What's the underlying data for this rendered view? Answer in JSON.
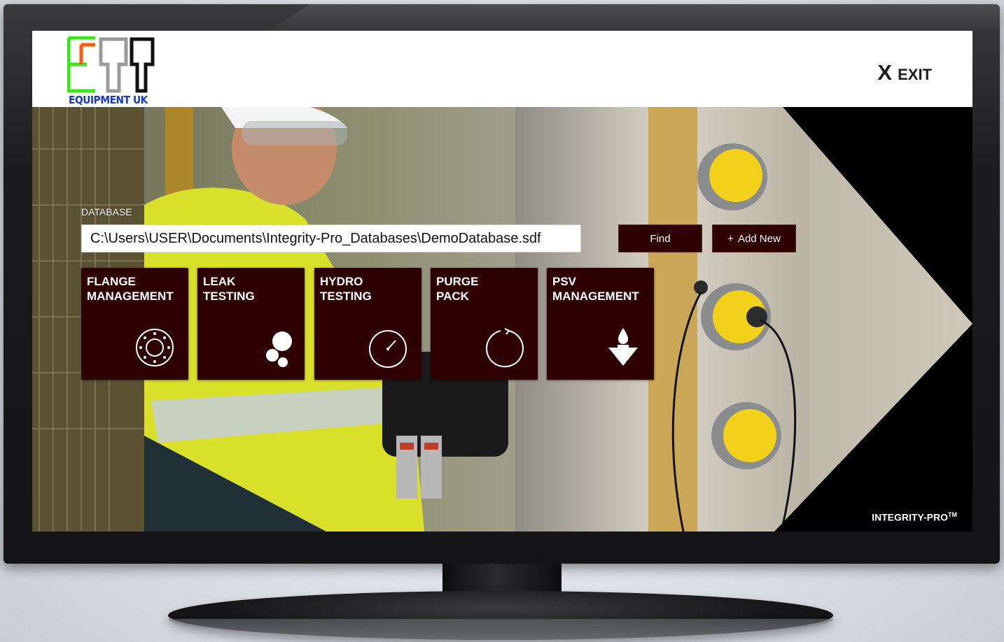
{
  "header": {
    "logo_text": "EQUIPMENT UK",
    "exit_x": "X",
    "exit_label": "EXIT"
  },
  "database": {
    "label": "DATABASE",
    "path": "C:\\Users\\USER\\Documents\\Integrity-Pro_Databases\\DemoDatabase.sdf",
    "find_label": "Find",
    "add_icon": "+",
    "add_label": "Add New"
  },
  "tiles": [
    {
      "title": "FLANGE\nMANAGEMENT",
      "icon": "flange-icon"
    },
    {
      "title": "LEAK\nTESTING",
      "icon": "bubbles-icon"
    },
    {
      "title": "HYDRO\nTESTING",
      "icon": "gauge-icon"
    },
    {
      "title": "PURGE\nPACK",
      "icon": "refresh-circle-icon"
    },
    {
      "title": "PSV\nMANAGEMENT",
      "icon": "drop-arrow-icon"
    }
  ],
  "footer": {
    "product": "INTEGRITY-PRO",
    "tm": "TM"
  },
  "colors": {
    "tile_bg": "#2e0102",
    "logo_text": "#1738c9",
    "logo_green": "#39e619",
    "logo_orange": "#ff5a0a",
    "logo_gray": "#9a9a9a",
    "logo_black": "#111111"
  }
}
